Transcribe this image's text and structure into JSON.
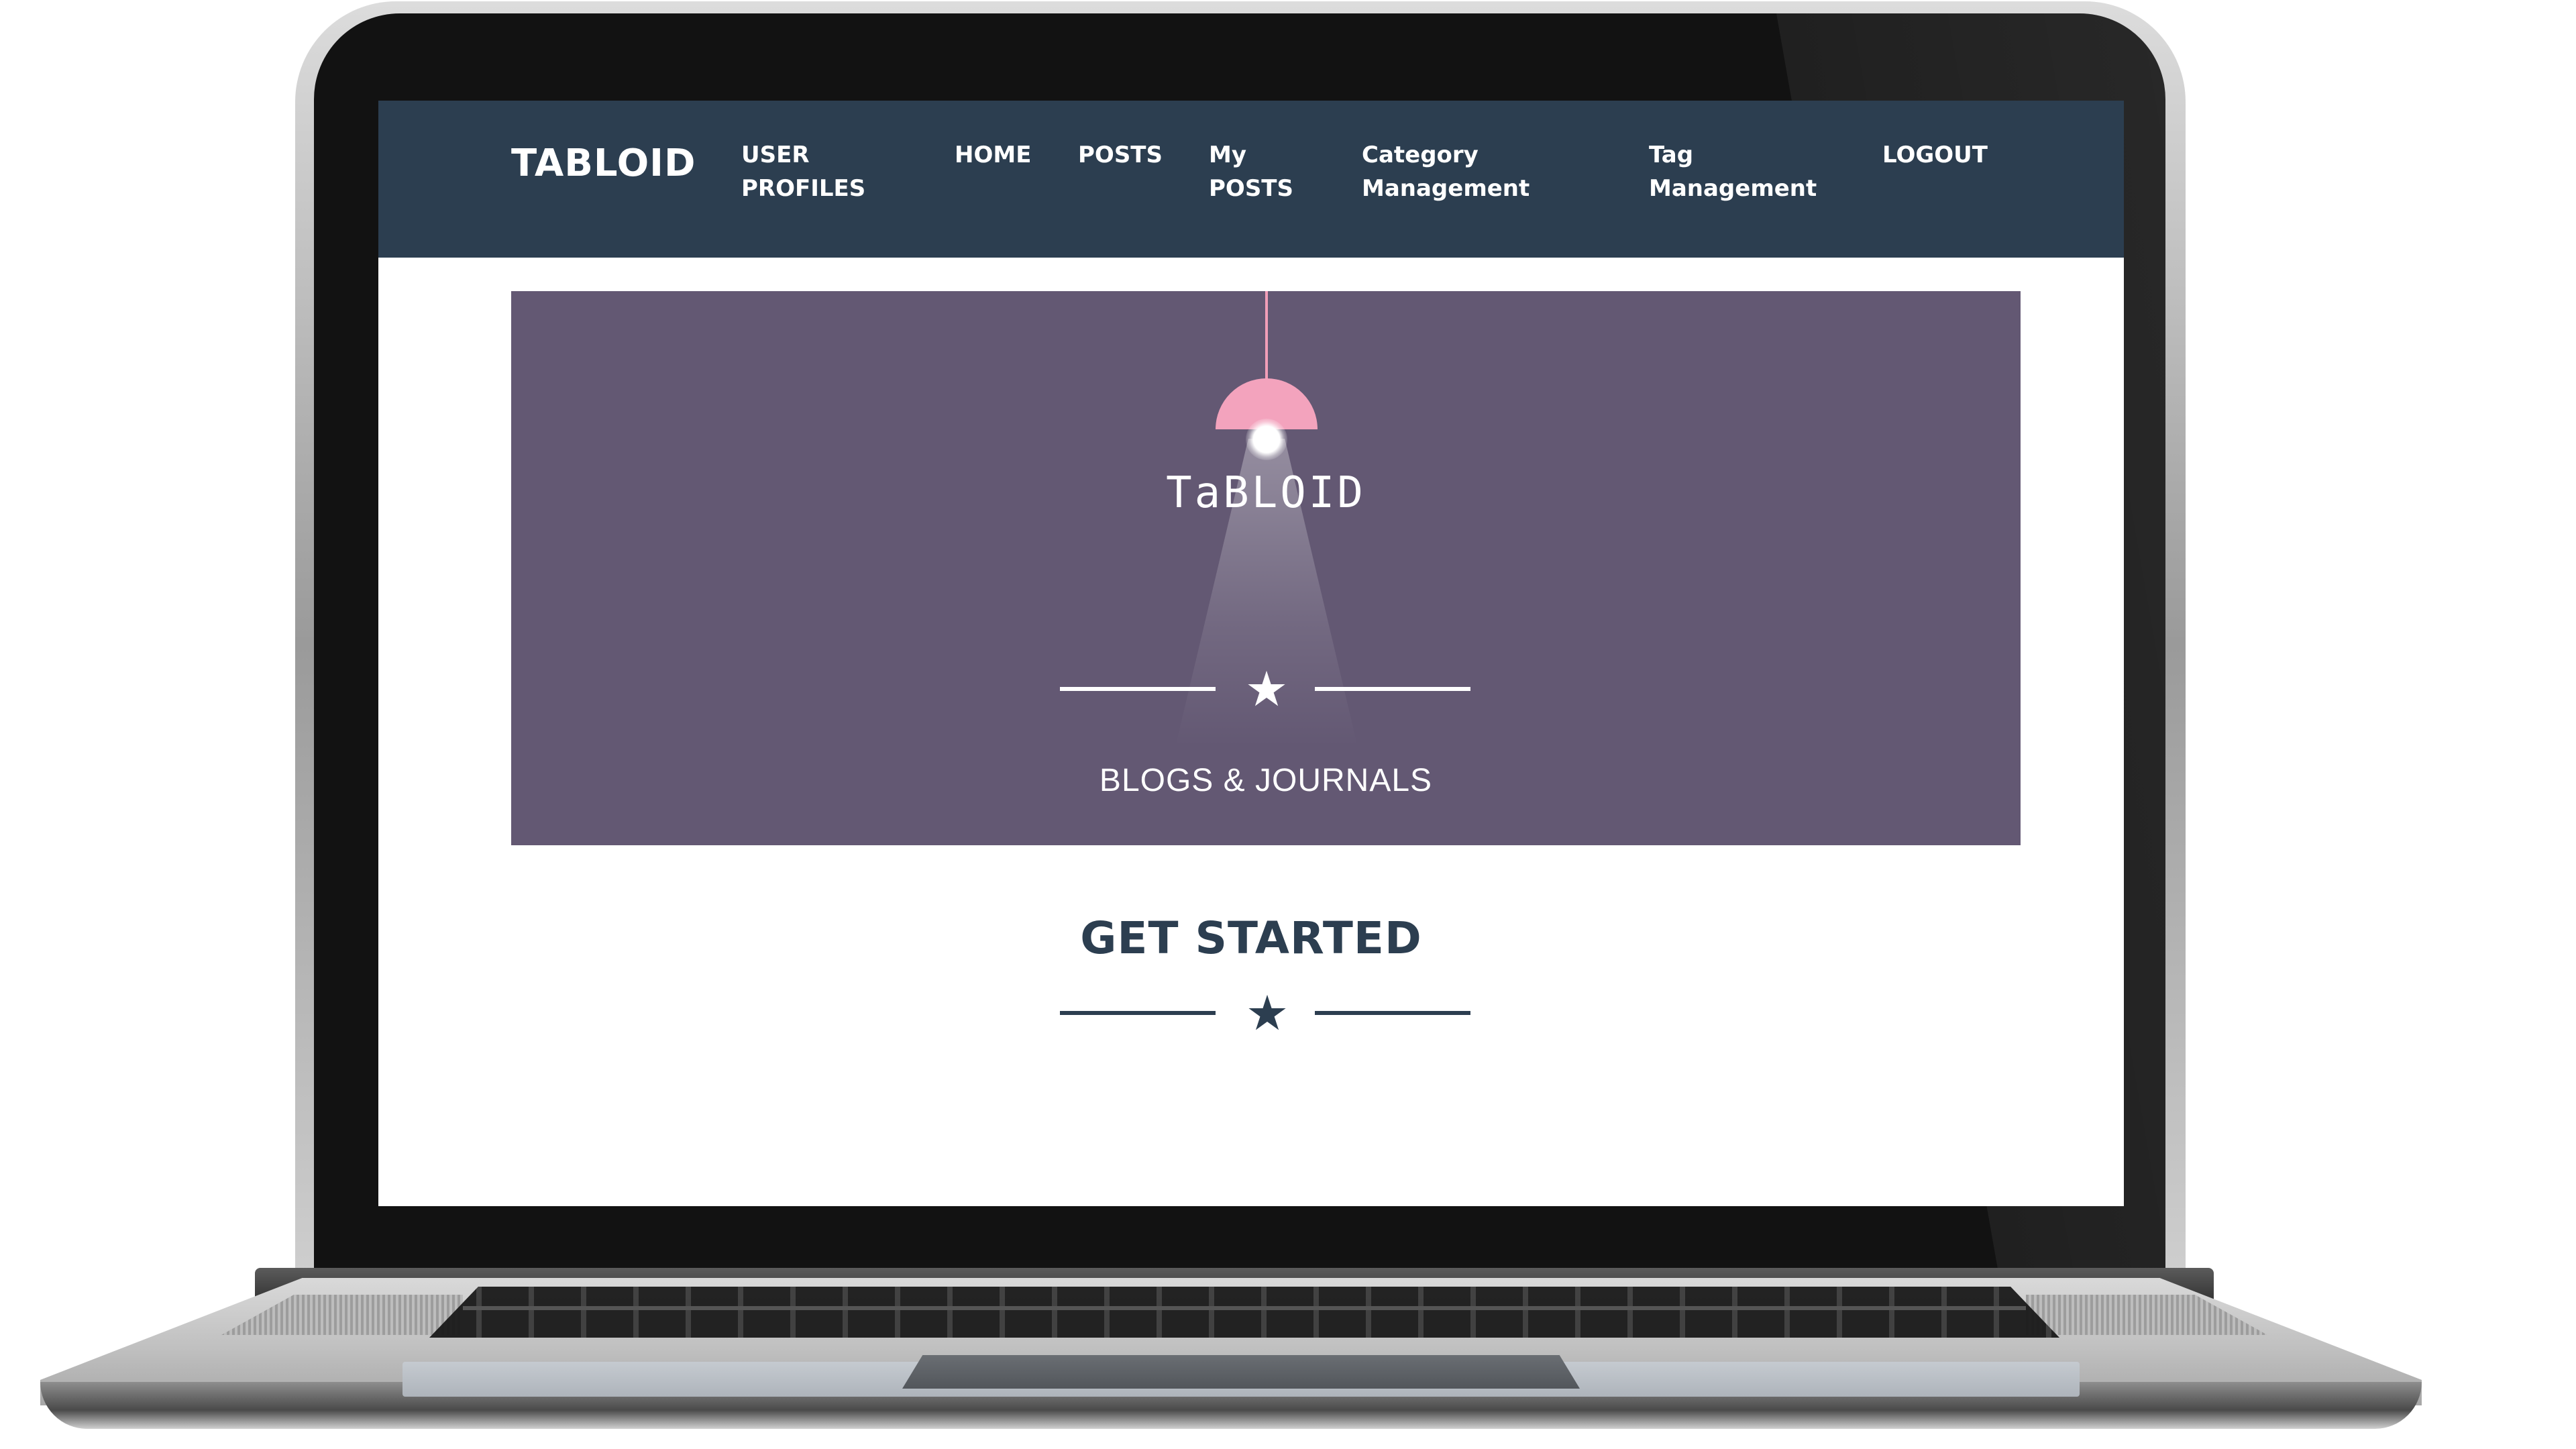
{
  "navbar": {
    "brand": "TABLOID",
    "links": [
      {
        "line1": "USER",
        "line2": "PROFILES"
      },
      {
        "line1": "HOME",
        "line2": ""
      },
      {
        "line1": "POSTS",
        "line2": ""
      },
      {
        "line1": "My",
        "line2": "POSTS"
      },
      {
        "line1": "Category",
        "line2": "Management"
      },
      {
        "line1": "Tag",
        "line2": "Management"
      },
      {
        "line1": "LOGOUT",
        "line2": ""
      }
    ]
  },
  "hero": {
    "logo_text": "TaBLOID",
    "star": "★",
    "subtitle": "BLOGS & JOURNALS"
  },
  "section": {
    "heading": "GET STARTED",
    "star": "★"
  },
  "colors": {
    "navbar_bg": "#2c3e50",
    "hero_bg": "#635873",
    "lamp_pink": "#f3a3bd",
    "heading": "#2c3e50"
  }
}
